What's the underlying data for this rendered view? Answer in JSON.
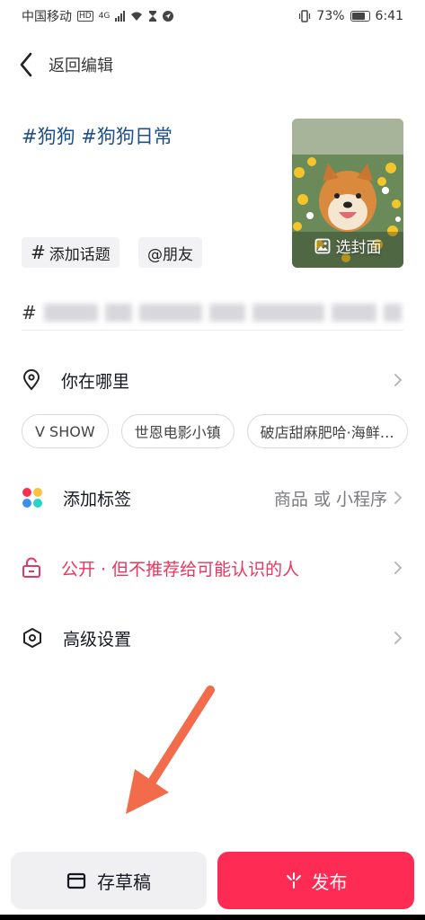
{
  "status_bar": {
    "carrier": "中国移动",
    "hd": "HD",
    "network": "4G",
    "battery": "73%",
    "time": "6:41"
  },
  "header": {
    "back_label": "返回编辑"
  },
  "caption": {
    "text": "#狗狗 #狗狗日常"
  },
  "cover": {
    "button_label": "选封面"
  },
  "chips": {
    "topic": "添加话题",
    "friends": "@朋友"
  },
  "suggestion_row": {
    "hash": "#"
  },
  "location": {
    "label": "你在哪里",
    "suggestions": [
      "V SHOW",
      "世恩电影小镇",
      "破店甜麻肥哈·海鲜…"
    ]
  },
  "tag": {
    "label": "添加标签",
    "extra": "商品 或 小程序"
  },
  "privacy": {
    "label": "公开 · 但不推荐给可能认识的人"
  },
  "advanced": {
    "label": "高级设置"
  },
  "bottom": {
    "draft_label": "存草稿",
    "publish_label": "发布"
  },
  "colors": {
    "accent": "#fe2c55",
    "privacy_text": "#e8365e",
    "caption_text": "#1e4f8a",
    "arrow": "#f26b4a"
  }
}
